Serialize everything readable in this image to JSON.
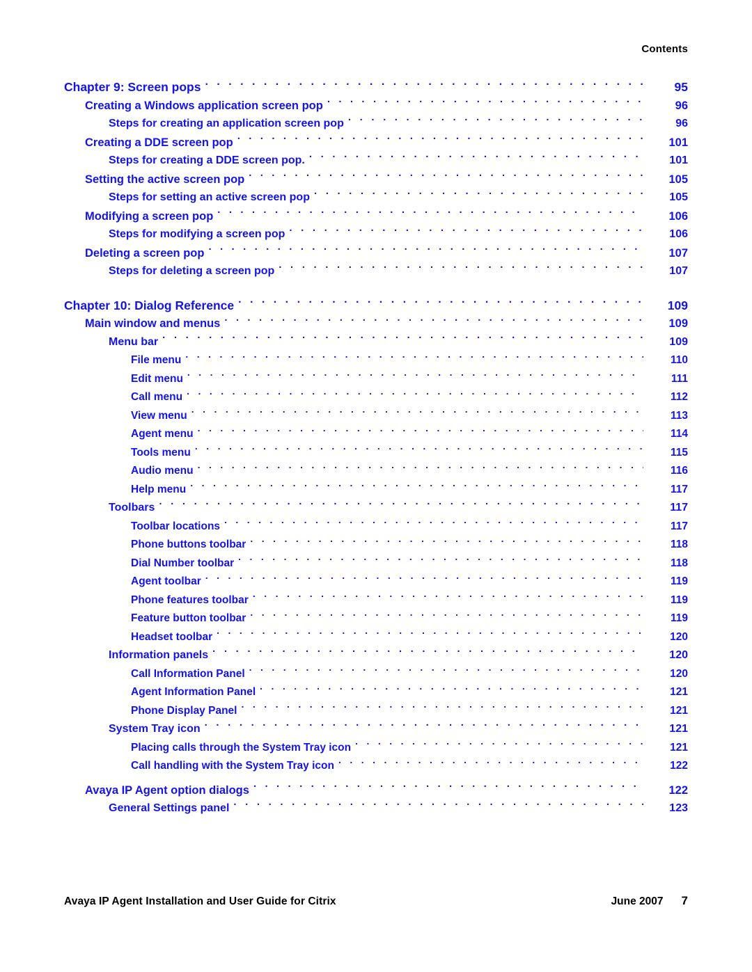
{
  "header": {
    "running_head": "Contents"
  },
  "toc": {
    "entries": [
      {
        "level": 0,
        "title": "Chapter 9: Screen pops",
        "page": "95",
        "gap": "none"
      },
      {
        "level": 1,
        "title": "Creating a Windows application screen pop",
        "page": "96",
        "gap": "none"
      },
      {
        "level": 2,
        "title": "Steps for creating an application screen pop",
        "page": "96",
        "gap": "none"
      },
      {
        "level": 1,
        "title": "Creating a DDE screen pop",
        "page": "101",
        "gap": "none"
      },
      {
        "level": 2,
        "title": "Steps for creating a DDE screen pop.",
        "page": "101",
        "gap": "none"
      },
      {
        "level": 1,
        "title": "Setting the active screen pop",
        "page": "105",
        "gap": "none"
      },
      {
        "level": 2,
        "title": "Steps for setting an active screen pop",
        "page": "105",
        "gap": "none"
      },
      {
        "level": 1,
        "title": "Modifying a screen pop",
        "page": "106",
        "gap": "none"
      },
      {
        "level": 2,
        "title": "Steps for modifying a screen pop",
        "page": "106",
        "gap": "none"
      },
      {
        "level": 1,
        "title": "Deleting a screen pop",
        "page": "107",
        "gap": "none"
      },
      {
        "level": 2,
        "title": "Steps for deleting a screen pop",
        "page": "107",
        "gap": "none"
      },
      {
        "level": 0,
        "title": "Chapter 10: Dialog Reference",
        "page": "109",
        "gap": "large"
      },
      {
        "level": 1,
        "title": "Main window and menus",
        "page": "109",
        "gap": "none"
      },
      {
        "level": 2,
        "title": "Menu bar",
        "page": "109",
        "gap": "none"
      },
      {
        "level": 3,
        "title": "File menu",
        "page": "110",
        "gap": "none"
      },
      {
        "level": 3,
        "title": "Edit menu",
        "page": "111",
        "gap": "none"
      },
      {
        "level": 3,
        "title": "Call menu",
        "page": "112",
        "gap": "none"
      },
      {
        "level": 3,
        "title": "View menu",
        "page": "113",
        "gap": "none"
      },
      {
        "level": 3,
        "title": "Agent menu",
        "page": "114",
        "gap": "none"
      },
      {
        "level": 3,
        "title": "Tools menu",
        "page": "115",
        "gap": "none"
      },
      {
        "level": 3,
        "title": "Audio menu",
        "page": "116",
        "gap": "none"
      },
      {
        "level": 3,
        "title": "Help menu",
        "page": "117",
        "gap": "none"
      },
      {
        "level": 2,
        "title": "Toolbars",
        "page": "117",
        "gap": "none"
      },
      {
        "level": 3,
        "title": "Toolbar locations",
        "page": "117",
        "gap": "none"
      },
      {
        "level": 3,
        "title": "Phone buttons toolbar",
        "page": "118",
        "gap": "none"
      },
      {
        "level": 3,
        "title": "Dial Number toolbar",
        "page": "118",
        "gap": "none"
      },
      {
        "level": 3,
        "title": "Agent toolbar",
        "page": "119",
        "gap": "none"
      },
      {
        "level": 3,
        "title": "Phone features toolbar",
        "page": "119",
        "gap": "none"
      },
      {
        "level": 3,
        "title": "Feature button toolbar",
        "page": "119",
        "gap": "none"
      },
      {
        "level": 3,
        "title": "Headset toolbar",
        "page": "120",
        "gap": "none"
      },
      {
        "level": 2,
        "title": "Information panels",
        "page": "120",
        "gap": "none"
      },
      {
        "level": 3,
        "title": "Call Information Panel",
        "page": "120",
        "gap": "none"
      },
      {
        "level": 3,
        "title": "Agent Information Panel",
        "page": "121",
        "gap": "none"
      },
      {
        "level": 3,
        "title": "Phone Display Panel",
        "page": "121",
        "gap": "none"
      },
      {
        "level": 2,
        "title": "System Tray icon",
        "page": "121",
        "gap": "none"
      },
      {
        "level": 3,
        "title": "Placing calls through the System Tray icon",
        "page": "121",
        "gap": "none"
      },
      {
        "level": 3,
        "title": "Call handling with the System Tray icon",
        "page": "122",
        "gap": "none"
      },
      {
        "level": 1,
        "title": "Avaya IP Agent option dialogs",
        "page": "122",
        "gap": "small"
      },
      {
        "level": 2,
        "title": "General Settings panel",
        "page": "123",
        "gap": "none"
      }
    ]
  },
  "footer": {
    "doc_title": "Avaya IP Agent Installation and User Guide for Citrix",
    "date": "June 2007",
    "page_number": "7"
  },
  "colors": {
    "link_blue": "#1414e6",
    "text_black": "#000000",
    "page_background": "#ffffff"
  }
}
